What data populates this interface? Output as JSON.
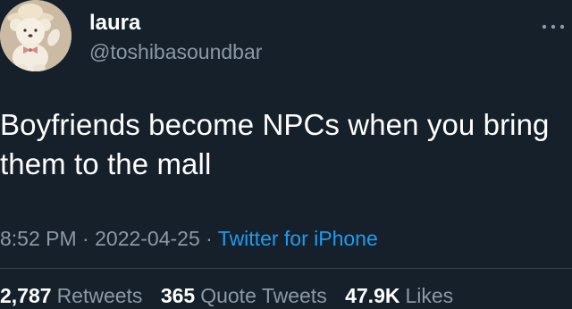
{
  "user": {
    "display_name": "laura",
    "handle": "@toshibasoundbar",
    "avatar": "teddy-bear-with-hat"
  },
  "tweet": {
    "text": "Boyfriends become NPCs when you bring them to the mall",
    "time": "8:52 PM",
    "date": "2022-04-25",
    "separator": "·",
    "source": "Twitter for iPhone"
  },
  "stats": {
    "retweets": {
      "count": "2,787",
      "label": "Retweets"
    },
    "quote_tweets": {
      "count": "365",
      "label": "Quote Tweets"
    },
    "likes": {
      "count": "47.9K",
      "label": "Likes"
    }
  },
  "icons": {
    "more": "more-horizontal-icon"
  },
  "colors": {
    "background": "#15202b",
    "text": "#ffffff",
    "secondary": "#8b98a5",
    "link": "#1d9bf0"
  }
}
